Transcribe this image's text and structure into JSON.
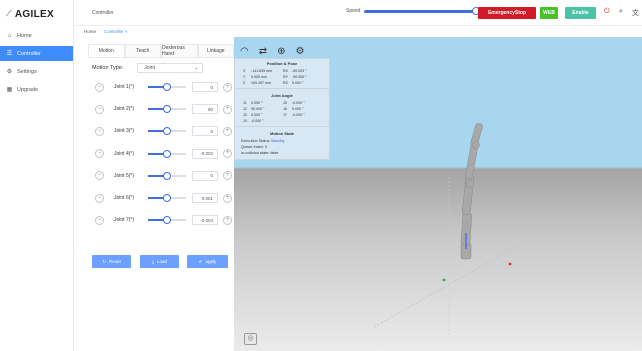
{
  "app": {
    "brand": "AGILEX"
  },
  "sidebar": {
    "items": [
      {
        "label": "Home",
        "icon": "home-icon",
        "glyph": "⌂",
        "active": false
      },
      {
        "label": "Controller",
        "icon": "controller-icon",
        "glyph": "☰",
        "active": true
      },
      {
        "label": "Settings",
        "icon": "gear-icon",
        "glyph": "⚙",
        "active": false
      },
      {
        "label": "Upgrade",
        "icon": "upgrade-icon",
        "glyph": "▦",
        "active": false
      }
    ]
  },
  "topbar": {
    "title": "Controller",
    "speed_label": "Speed",
    "speed_value": 1.0,
    "estop_label": "EmergencyStop",
    "web_label": "WEB",
    "enable_label": "Enable",
    "icons": [
      "power-icon",
      "search-icon",
      "language-icon"
    ]
  },
  "breadcrumbs": {
    "home": "Home",
    "current": "Controller ×"
  },
  "panel": {
    "tabs": [
      "Motion",
      "Teach",
      "Dexterous Hand",
      "Linkage"
    ],
    "active_tab": 0,
    "motion_type_label": "Motion Type:",
    "motion_type_value": "Joint",
    "joints": [
      {
        "label": "Joint 1(°)",
        "value": "0",
        "pos": 0.5
      },
      {
        "label": "Joint 2(°)",
        "value": "90",
        "pos": 0.5
      },
      {
        "label": "Joint 3(°)",
        "value": "0",
        "pos": 0.5
      },
      {
        "label": "Joint 4(°)",
        "value": "-0.002",
        "pos": 0.5
      },
      {
        "label": "Joint 5(°)",
        "value": "0",
        "pos": 0.5
      },
      {
        "label": "Joint 6(°)",
        "value": "0.001",
        "pos": 0.5
      },
      {
        "label": "Joint 7(°)",
        "value": "-0.004",
        "pos": 0.5
      }
    ],
    "actions": [
      {
        "label": "Reset",
        "glyph": "↻"
      },
      {
        "label": "Load",
        "glyph": "⤓"
      },
      {
        "label": "apply",
        "glyph": "✔"
      }
    ]
  },
  "overlay": {
    "pose_title": "Position & Pose",
    "pose_rows": [
      [
        "X",
        "-141.635 mm",
        "RX",
        "-90.003 °"
      ],
      [
        "Y",
        "0.000 mm",
        "RY",
        "-90.000 °"
      ],
      [
        "Z",
        "109.497 mm",
        "RZ",
        "0.002 °"
      ]
    ],
    "joint_title": "Joint Angle",
    "joint_rows": [
      [
        "J1",
        "0.000 °",
        "J5",
        "-0.000 °"
      ],
      [
        "J2",
        "90.000 °",
        "J6",
        "0.000 °"
      ],
      [
        "J3",
        "0.000 °",
        "J7",
        "-0.000 °"
      ],
      [
        "J4",
        "-0.000 °",
        "",
        ""
      ]
    ],
    "motion_title": "Motion State",
    "exec_label": "Execution Status",
    "exec_value": "Standby",
    "queue_label": "Queue Index",
    "queue_value": "0",
    "collision_label": "In-collision state",
    "collision_value": "false"
  },
  "colors": {
    "accent": "#3f8cff",
    "estop": "#d11a2a",
    "web": "#49c229",
    "enable": "#4bc3a8"
  }
}
